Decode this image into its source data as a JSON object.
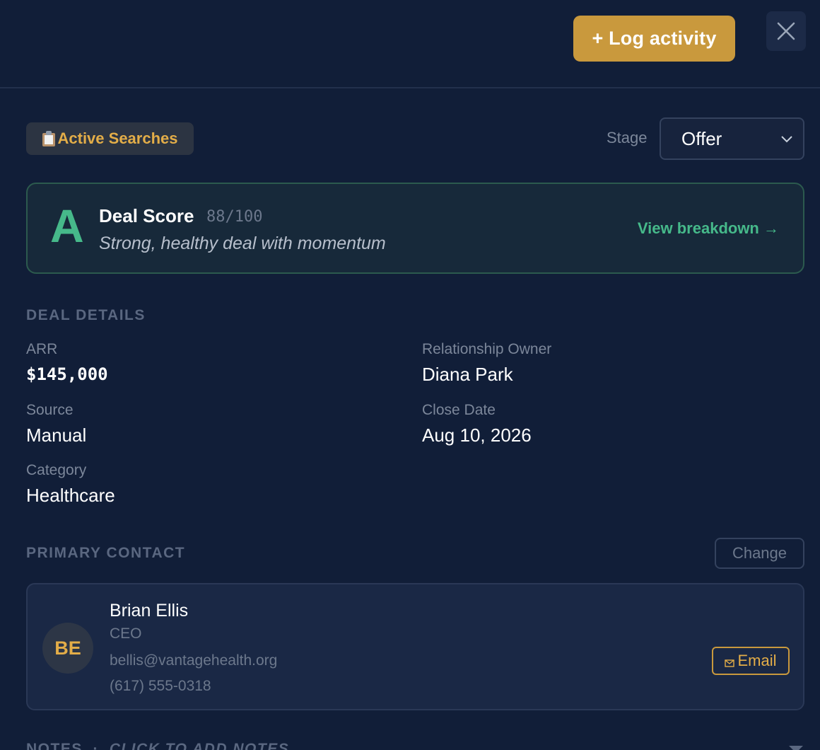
{
  "header": {
    "log_activity_label": "+ Log activity",
    "close_icon": "close-icon"
  },
  "pipeline_badge": {
    "icon": "clipboard-icon",
    "label": "Active Searches"
  },
  "stage": {
    "label": "Stage",
    "selected": "Offer"
  },
  "deal_score": {
    "grade": "A",
    "title": "Deal Score",
    "value": "88/100",
    "description": "Strong, healthy deal with momentum",
    "breakdown_link": "View breakdown →"
  },
  "deal_details": {
    "heading": "DEAL DETAILS",
    "fields": [
      {
        "label": "ARR",
        "value": "$145,000"
      },
      {
        "label": "Relationship Owner",
        "value": "Diana Park"
      },
      {
        "label": "Source",
        "value": "Manual"
      },
      {
        "label": "Close Date",
        "value": "Aug 10, 2026"
      },
      {
        "label": "Category",
        "value": "Healthcare"
      }
    ]
  },
  "primary_contact": {
    "heading": "PRIMARY CONTACT",
    "change_label": "Change",
    "initials": "BE",
    "name": "Brian Ellis",
    "role": "CEO",
    "email": "bellis@vantagehealth.org",
    "phone": "(617) 555-0318",
    "email_button_label": "Email"
  },
  "notes": {
    "heading": "NOTES",
    "hint": "CLICK TO ADD NOTES"
  },
  "colors": {
    "background": "#111e38",
    "accent_gold": "#c9993d",
    "accent_green": "#46b98a"
  }
}
